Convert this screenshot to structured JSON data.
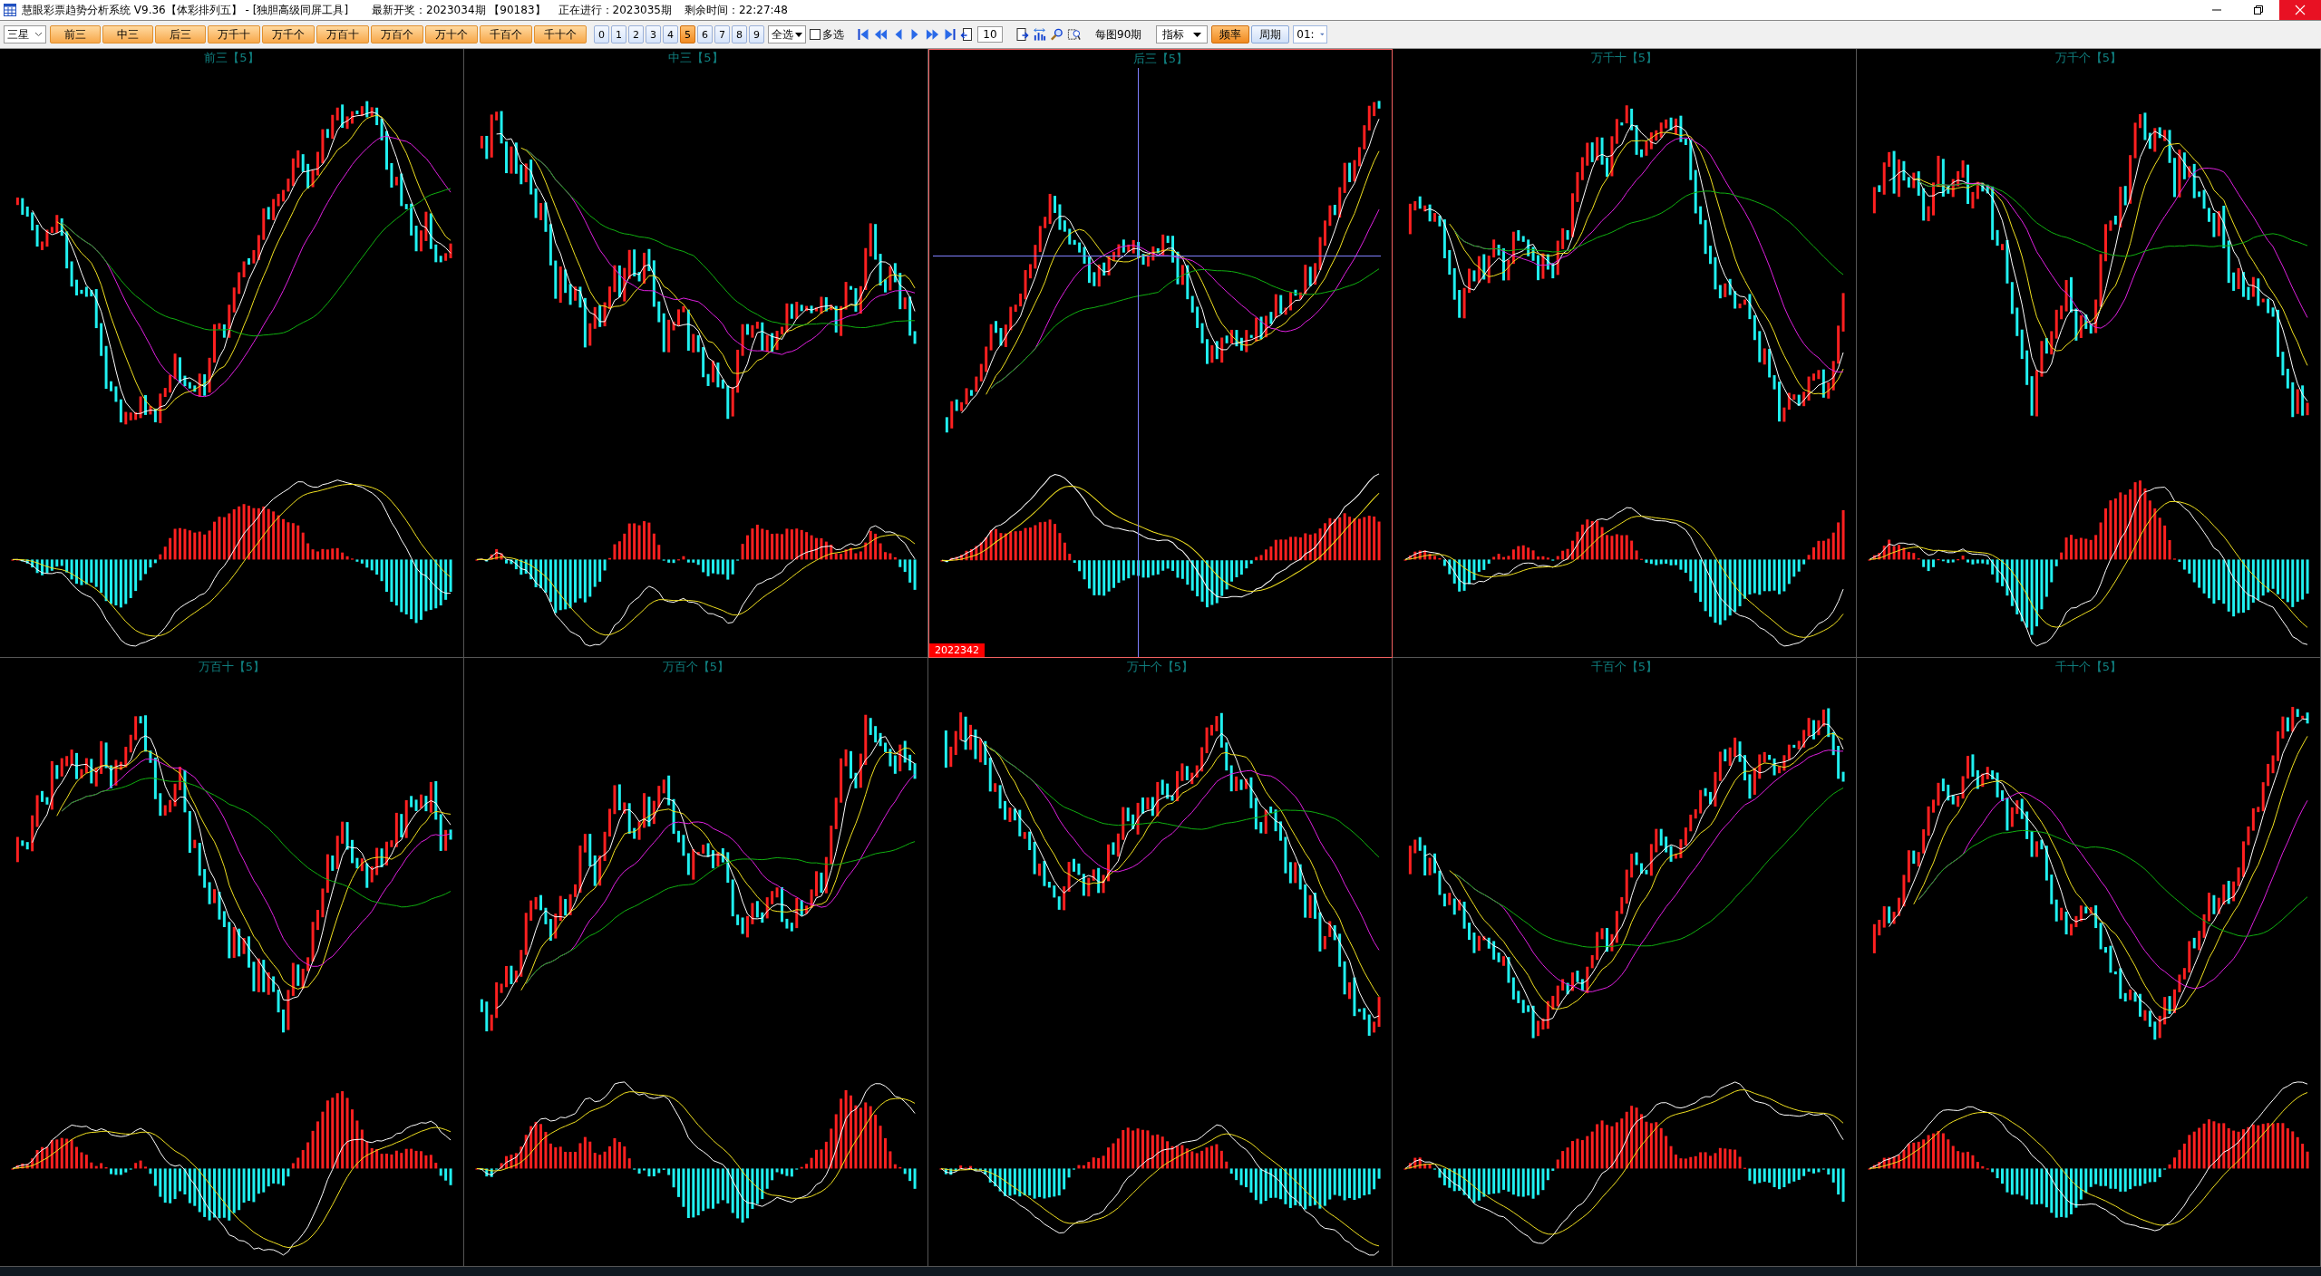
{
  "window": {
    "title": "慧眼彩票趋势分析系统 V9.36【体彩排列五】 - [独胆高级同屏工具]",
    "latest_draw": "最新开奖：2023034期 【90183】",
    "in_progress": "正在进行：2023035期",
    "remaining": "剩余时间：22:27:48"
  },
  "toolbar": {
    "star_select": "三星",
    "groups": [
      {
        "label": "前三"
      },
      {
        "label": "中三"
      },
      {
        "label": "后三"
      },
      {
        "label": "万千十"
      },
      {
        "label": "万千个"
      },
      {
        "label": "万百十"
      },
      {
        "label": "万百个"
      },
      {
        "label": "万十个"
      },
      {
        "label": "千百个"
      },
      {
        "label": "千十个"
      }
    ],
    "digits": [
      {
        "label": "0",
        "selected": false
      },
      {
        "label": "1",
        "selected": false
      },
      {
        "label": "2",
        "selected": false
      },
      {
        "label": "3",
        "selected": false
      },
      {
        "label": "4",
        "selected": false
      },
      {
        "label": "5",
        "selected": true
      },
      {
        "label": "6",
        "selected": false
      },
      {
        "label": "7",
        "selected": false
      },
      {
        "label": "8",
        "selected": false
      },
      {
        "label": "9",
        "selected": false
      }
    ],
    "select_all": "全选",
    "multi_select": {
      "label": "多选",
      "checked": false
    },
    "page_size": "10",
    "periods_label": "每图90期",
    "indicator": "指标",
    "modes": [
      {
        "label": "频率",
        "selected": true
      },
      {
        "label": "周期",
        "selected": false
      }
    ],
    "time_select": "01:"
  },
  "panels": [
    {
      "title": "前三【5】",
      "selected": false
    },
    {
      "title": "中三【5】",
      "selected": false
    },
    {
      "title": "后三【5】",
      "selected": true,
      "cursor_label": "2022342"
    },
    {
      "title": "万千十【5】",
      "selected": false
    },
    {
      "title": "万千个【5】",
      "selected": false
    },
    {
      "title": "万百十【5】",
      "selected": false
    },
    {
      "title": "万百个【5】",
      "selected": false
    },
    {
      "title": "万十个【5】",
      "selected": false
    },
    {
      "title": "千百个【5】",
      "selected": false
    },
    {
      "title": "千十个【5】",
      "selected": false
    }
  ]
}
